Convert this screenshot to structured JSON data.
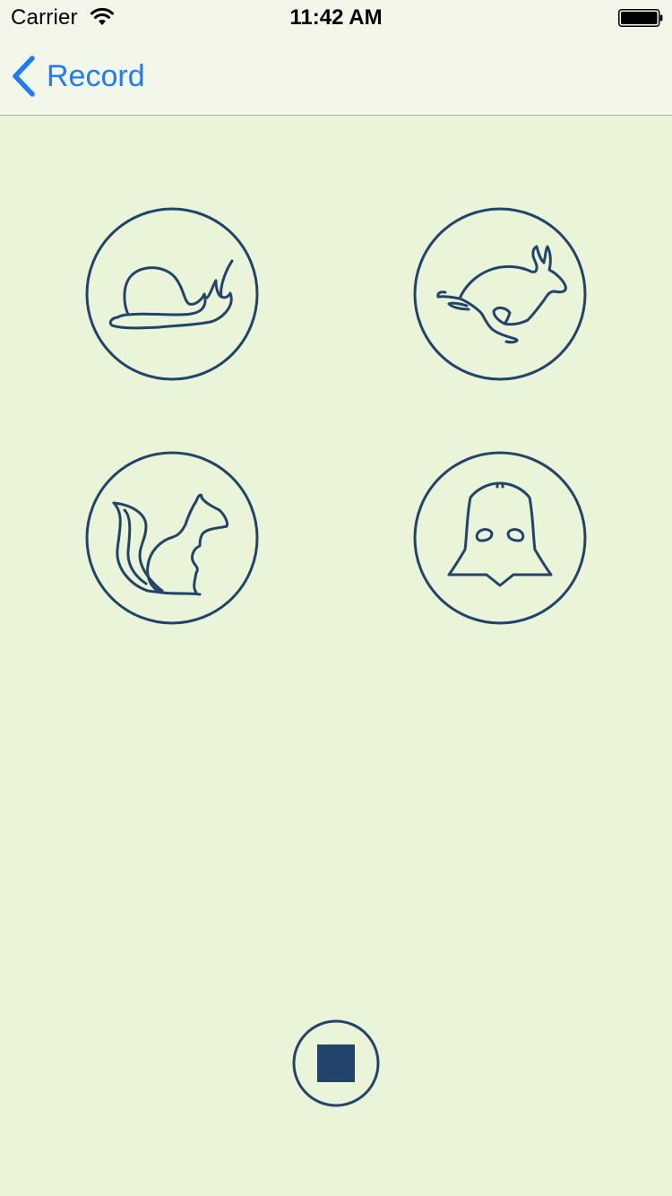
{
  "status_bar": {
    "carrier": "Carrier",
    "time": "11:42 AM",
    "wifi_icon": "wifi-icon",
    "battery_icon": "battery-icon"
  },
  "nav_bar": {
    "back_label": "Record",
    "back_icon": "chevron-left-icon"
  },
  "effects": [
    {
      "name": "slow",
      "icon": "snail-icon"
    },
    {
      "name": "fast",
      "icon": "rabbit-icon"
    },
    {
      "name": "chipmunk",
      "icon": "squirrel-icon"
    },
    {
      "name": "darth-vader",
      "icon": "vader-helmet-icon"
    }
  ],
  "stop_button": {
    "icon": "stop-icon"
  },
  "colors": {
    "background": "#EAF4D8",
    "bar_background": "#F2F7EA",
    "accent": "#1F7BF6",
    "icon_stroke": "#22446B",
    "divider": "#A9AFA3"
  }
}
